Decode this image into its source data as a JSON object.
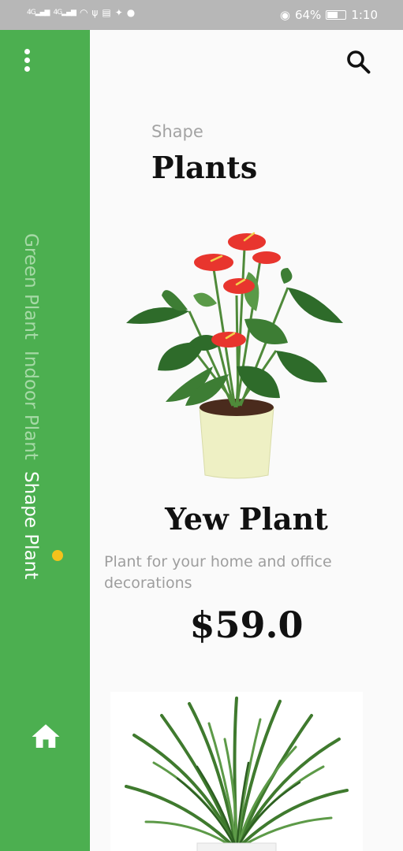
{
  "status_bar": {
    "signal_1": "4G",
    "signal_2": "4G",
    "battery": "64%",
    "battery_level": 0.64,
    "time": "1:10"
  },
  "sidebar": {
    "nav": [
      {
        "label": "Green Plant",
        "active": false
      },
      {
        "label": "Indoor Plant",
        "active": false
      },
      {
        "label": "Shape Plant",
        "active": true
      }
    ]
  },
  "header": {
    "subtitle": "Shape",
    "title": "Plants"
  },
  "product": {
    "name": "Yew Plant",
    "description": "Plant for your home and office decorations",
    "price": "$59.0"
  },
  "icons": {
    "menu": "more-vert-icon",
    "search": "search-icon",
    "home": "home-icon"
  },
  "colors": {
    "sidebar": "#4caf50",
    "active_dot": "#f4c21b",
    "flower": "#e8352e",
    "leaf": "#2e6b2a"
  }
}
